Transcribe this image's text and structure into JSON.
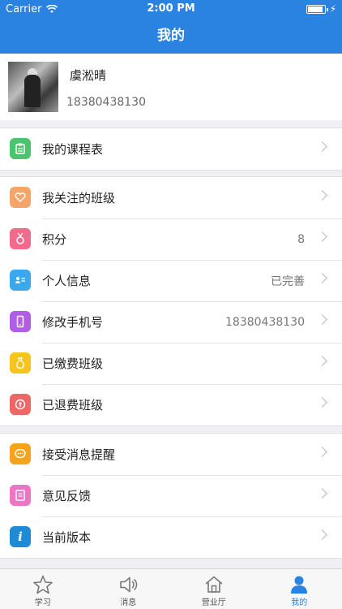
{
  "status_bar": {
    "carrier": "Carrier",
    "time": "2:00 PM"
  },
  "nav": {
    "title": "我的"
  },
  "profile": {
    "name": "虞淞晴",
    "phone": "18380438130"
  },
  "groups": [
    {
      "items": [
        {
          "label": "我的课程表",
          "value": "",
          "icon": "clipboard-icon",
          "color": "#4cc36f"
        }
      ]
    },
    {
      "items": [
        {
          "label": "我关注的班级",
          "value": "",
          "icon": "heart-icon",
          "color": "#f6a56a"
        },
        {
          "label": "积分",
          "value": "8",
          "icon": "medal-icon",
          "color": "#f26a8c"
        },
        {
          "label": "个人信息",
          "value": "已完善",
          "icon": "id-card-icon",
          "color": "#3aa8ef"
        },
        {
          "label": "修改手机号",
          "value": "18380438130",
          "icon": "phone-icon",
          "color": "#b25de6"
        },
        {
          "label": "已缴费班级",
          "value": "",
          "icon": "money-bag-icon",
          "color": "#f7c31d"
        },
        {
          "label": "已退费班级",
          "value": "",
          "icon": "refund-icon",
          "color": "#f06565"
        }
      ]
    },
    {
      "items": [
        {
          "label": "接受消息提醒",
          "value": "",
          "icon": "chat-icon",
          "color": "#f7a21b"
        },
        {
          "label": "意见反馈",
          "value": "",
          "icon": "feedback-icon",
          "color": "#ef74c4"
        },
        {
          "label": "当前版本",
          "value": "",
          "icon": "info-icon",
          "color": "#1f8ad6"
        }
      ]
    }
  ],
  "tabs": [
    {
      "label": "学习",
      "icon": "star-icon",
      "active": false
    },
    {
      "label": "消息",
      "icon": "speaker-icon",
      "active": false
    },
    {
      "label": "营业厅",
      "icon": "home-icon",
      "active": false
    },
    {
      "label": "我的",
      "icon": "person-icon",
      "active": true
    }
  ],
  "colors": {
    "accent": "#2a83e0",
    "background": "#efeff4"
  }
}
